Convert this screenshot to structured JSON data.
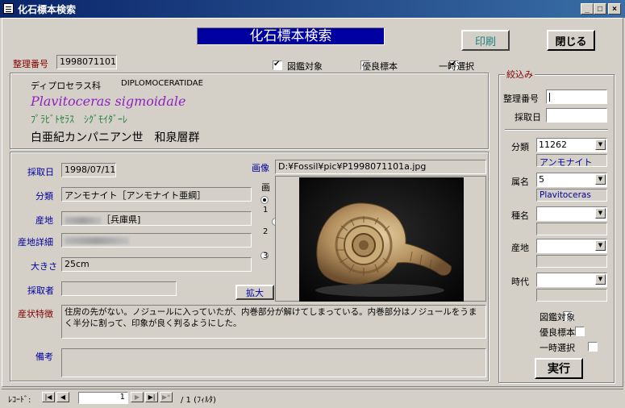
{
  "window": {
    "title": "化石標本検索",
    "minimize": "_",
    "maximize": "□",
    "close": "×"
  },
  "header": {
    "banner": "化石標本検索",
    "print_label": "印刷",
    "close_label": "閉じる"
  },
  "top": {
    "seiri_label": "整理番号",
    "seiri_value": "1998071101",
    "checks": [
      {
        "label": "図鑑対象",
        "checked": true
      },
      {
        "label": "優良標本",
        "checked": false
      },
      {
        "label": "一時選択",
        "checked": true
      }
    ]
  },
  "taxon": {
    "family_ja": "ディプロセラス科",
    "family_en": "DIPLOMOCERATIDAE",
    "species_latin": "Plavitoceras sigmoidale",
    "species_kana": "ﾌﾟﾗﾋﾞﾄｾﾗｽ　ｼｸﾞﾓｲﾀﾞｰﾚ",
    "era": "白亜紀カンパニアン世　和泉層群"
  },
  "detail": {
    "date_label": "採取日",
    "date_value": "1998/07/11",
    "class_label": "分類",
    "class_value": "アンモナイト［アンモナイト亜綱］",
    "place_label": "産地",
    "place_value": "［兵庫県]",
    "place_detail_label": "産地詳細",
    "place_detail_value": "",
    "size_label": "大きさ",
    "size_value": "25cm",
    "collector_label": "採取者",
    "collector_value": "",
    "image_label": "画像",
    "image_path": "D:¥Fossil¥pic¥P1998071101a.jpg",
    "image_selector_label": "画",
    "image_options": [
      "1",
      "2",
      "3"
    ],
    "zoom_label": "拡大",
    "feature_label": "産状特徴",
    "feature_value": "住房の先がない。ノジュールに入っていたが、内巻部分が解けてしまっている。内巻部分はノジュールをうまく半分に割って、印象が良く判るようにした。",
    "note_label": "備考",
    "note_value": ""
  },
  "filter": {
    "title": "絞込み",
    "seiri_label": "整理番号",
    "date_label": "採取日",
    "class_label": "分類",
    "class_value": "11262",
    "class_name": "アンモナイト",
    "genus_label": "属名",
    "genus_value": "5",
    "genus_name": "Plavitoceras",
    "species_label": "種名",
    "place_label": "産地",
    "era_label": "時代",
    "checks": [
      "図鑑対象",
      "優良標本",
      "一時選択"
    ],
    "run_label": "実行"
  },
  "recordnav": {
    "label": "ﾚｺｰﾄﾞ:",
    "current": "1",
    "total_text": "/  1 (ﾌｨﾙﾀ)"
  }
}
